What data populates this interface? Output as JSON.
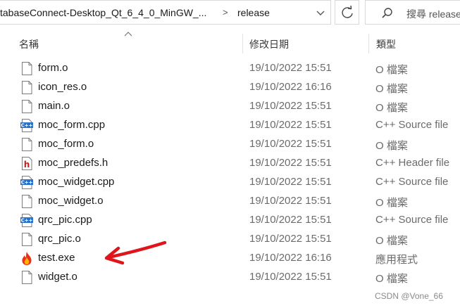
{
  "address": {
    "path_segment_1": "tabaseConnect-Desktop_Qt_6_4_0_MinGW_...",
    "separator": ">",
    "path_segment_2": "release"
  },
  "search": {
    "placeholder": "搜尋 release"
  },
  "columns": {
    "name": "名稱",
    "date": "修改日期",
    "type": "類型"
  },
  "files": [
    {
      "name": "form.o",
      "date": "19/10/2022 15:51",
      "type": "O 檔案",
      "icon": "blank-file-icon"
    },
    {
      "name": "icon_res.o",
      "date": "19/10/2022 16:16",
      "type": "O 檔案",
      "icon": "blank-file-icon"
    },
    {
      "name": "main.o",
      "date": "19/10/2022 15:51",
      "type": "O 檔案",
      "icon": "blank-file-icon"
    },
    {
      "name": "moc_form.cpp",
      "date": "19/10/2022 15:51",
      "type": "C++ Source file",
      "icon": "cpp-file-icon"
    },
    {
      "name": "moc_form.o",
      "date": "19/10/2022 15:51",
      "type": "O 檔案",
      "icon": "blank-file-icon"
    },
    {
      "name": "moc_predefs.h",
      "date": "19/10/2022 15:51",
      "type": "C++ Header file",
      "icon": "header-file-icon"
    },
    {
      "name": "moc_widget.cpp",
      "date": "19/10/2022 15:51",
      "type": "C++ Source file",
      "icon": "cpp-file-icon"
    },
    {
      "name": "moc_widget.o",
      "date": "19/10/2022 15:51",
      "type": "O 檔案",
      "icon": "blank-file-icon"
    },
    {
      "name": "qrc_pic.cpp",
      "date": "19/10/2022 15:51",
      "type": "C++ Source file",
      "icon": "cpp-file-icon"
    },
    {
      "name": "qrc_pic.o",
      "date": "19/10/2022 15:51",
      "type": "O 檔案",
      "icon": "blank-file-icon"
    },
    {
      "name": "test.exe",
      "date": "19/10/2022 16:16",
      "type": "應用程式",
      "icon": "flame-app-icon"
    },
    {
      "name": "widget.o",
      "date": "19/10/2022 15:51",
      "type": "O 檔案",
      "icon": "blank-file-icon"
    }
  ],
  "colors": {
    "annotation_arrow": "#e0141b",
    "cpp_icon": "#2a72c9",
    "header_icon": "#c81e1e",
    "flame_outer": "#e8331c",
    "flame_inner": "#ffb400"
  },
  "watermark": "CSDN @Vone_66"
}
